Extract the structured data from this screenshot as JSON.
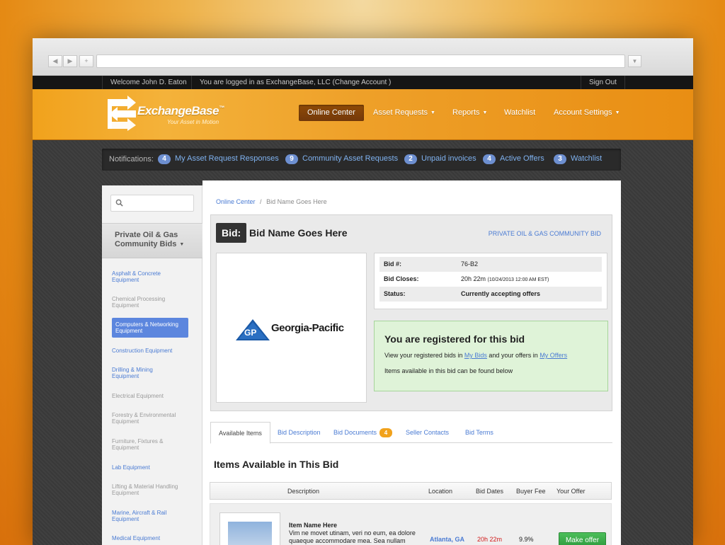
{
  "browser": {
    "back": "◀",
    "forward": "▶",
    "new_tab": "+",
    "menu": "▼"
  },
  "userbar": {
    "welcome": "Welcome John D. Eaton",
    "logged_in": "You are logged in as ExchangeBase, LLC  (Change Account )",
    "sign_out": "Sign Out"
  },
  "brand": {
    "name": "ExchangeBase",
    "tagline": "Your Asset in Motion",
    "tm": "™"
  },
  "nav": {
    "items": [
      {
        "label": "Online Center",
        "active": true
      },
      {
        "label": "Asset Requests",
        "dropdown": true
      },
      {
        "label": "Reports",
        "dropdown": true
      },
      {
        "label": "Watchlist"
      },
      {
        "label": "Account Settings",
        "dropdown": true
      }
    ]
  },
  "notifications": {
    "label": "Notifications:",
    "items": [
      {
        "count": "4",
        "label": "My Asset Request Responses"
      },
      {
        "count": "9",
        "label": "Community Asset Requests"
      },
      {
        "count": "2",
        "label": "Unpaid invoices"
      },
      {
        "count": "4",
        "label": "Active Offers"
      },
      {
        "count": "3",
        "label": "Watchlist"
      }
    ]
  },
  "sidebar": {
    "search_placeholder": "",
    "heading_line1": "Private Oil & Gas",
    "heading_line2": "Community Bids",
    "items": [
      {
        "l1": "Asphalt & Concrete",
        "l2": "Equipment",
        "state": "link"
      },
      {
        "l1": "Chemical Processing",
        "l2": "Equipment",
        "state": "muted"
      },
      {
        "l1": "Computers & Networking",
        "l2": "Equipment",
        "state": "active"
      },
      {
        "l1": "Construction Equipment",
        "l2": "",
        "state": "link"
      },
      {
        "l1": "Drilling & Mining",
        "l2": "Equipment",
        "state": "link"
      },
      {
        "l1": "Electrical Equipment",
        "l2": "",
        "state": "muted"
      },
      {
        "l1": "Forestry & Environmental",
        "l2": "Equipment",
        "state": "muted"
      },
      {
        "l1": "Furniture, Fixtures &",
        "l2": "Equipment",
        "state": "muted"
      },
      {
        "l1": "Lab Equipment",
        "l2": "",
        "state": "link"
      },
      {
        "l1": "Lifting & Material Handling",
        "l2": "Equipment",
        "state": "muted"
      },
      {
        "l1": "Marine, Aircraft & Rail",
        "l2": "Equipment",
        "state": "link"
      },
      {
        "l1": "Medical Equipment",
        "l2": "",
        "state": "link"
      }
    ]
  },
  "breadcrumb": {
    "root": "Online Center",
    "sep": "/",
    "current": "Bid Name Goes Here"
  },
  "bid": {
    "tag": "Bid:",
    "title": "Bid Name Goes Here",
    "category": "PRIVATE OIL & GAS COMMUNITY BID",
    "company_logo_text": "Georgia-Pacific",
    "company_logo_mark": "GP",
    "info": [
      {
        "key": "Bid #:",
        "value": "76-B2"
      },
      {
        "key": "Bid Closes:",
        "value": "20h 22m",
        "note": "(10/24/2013 12:00 AM EST)"
      },
      {
        "key": "Status:",
        "value": "Currently accepting offers"
      }
    ]
  },
  "registered": {
    "title": "You are registered for this bid",
    "line1_pre": "View your registered bids in ",
    "my_bids": "My Bids",
    "line1_mid": " and your offers in ",
    "my_offers": "My Offers",
    "line2": "Items available in this bid can be found below"
  },
  "tabs": [
    {
      "label": "Available Items",
      "active": true
    },
    {
      "label": "Bid Description"
    },
    {
      "label": "Bid Documents",
      "badge": "4"
    },
    {
      "label": "Seller Contacts"
    },
    {
      "label": "Bid Terms"
    }
  ],
  "items_section": {
    "title": "Items Available in This Bid",
    "columns": [
      "Description",
      "Location",
      "Bid Dates",
      "Buyer Fee",
      "Your Offer"
    ],
    "rows": [
      {
        "name": "Item Name Here",
        "description": "Vim ne movet utinam, veri no eum, ea dolore quaeque accommodare mea. Sea nullam",
        "location": "Atlanta, GA",
        "bid_dates": "20h 22m",
        "buyer_fee": "9.9%",
        "action": "Make offer"
      }
    ]
  },
  "colors": {
    "accent_orange": "#f1a21c",
    "link_blue": "#4a7bd3",
    "success_green": "#26a33a",
    "alert_red": "#d11a1a"
  }
}
